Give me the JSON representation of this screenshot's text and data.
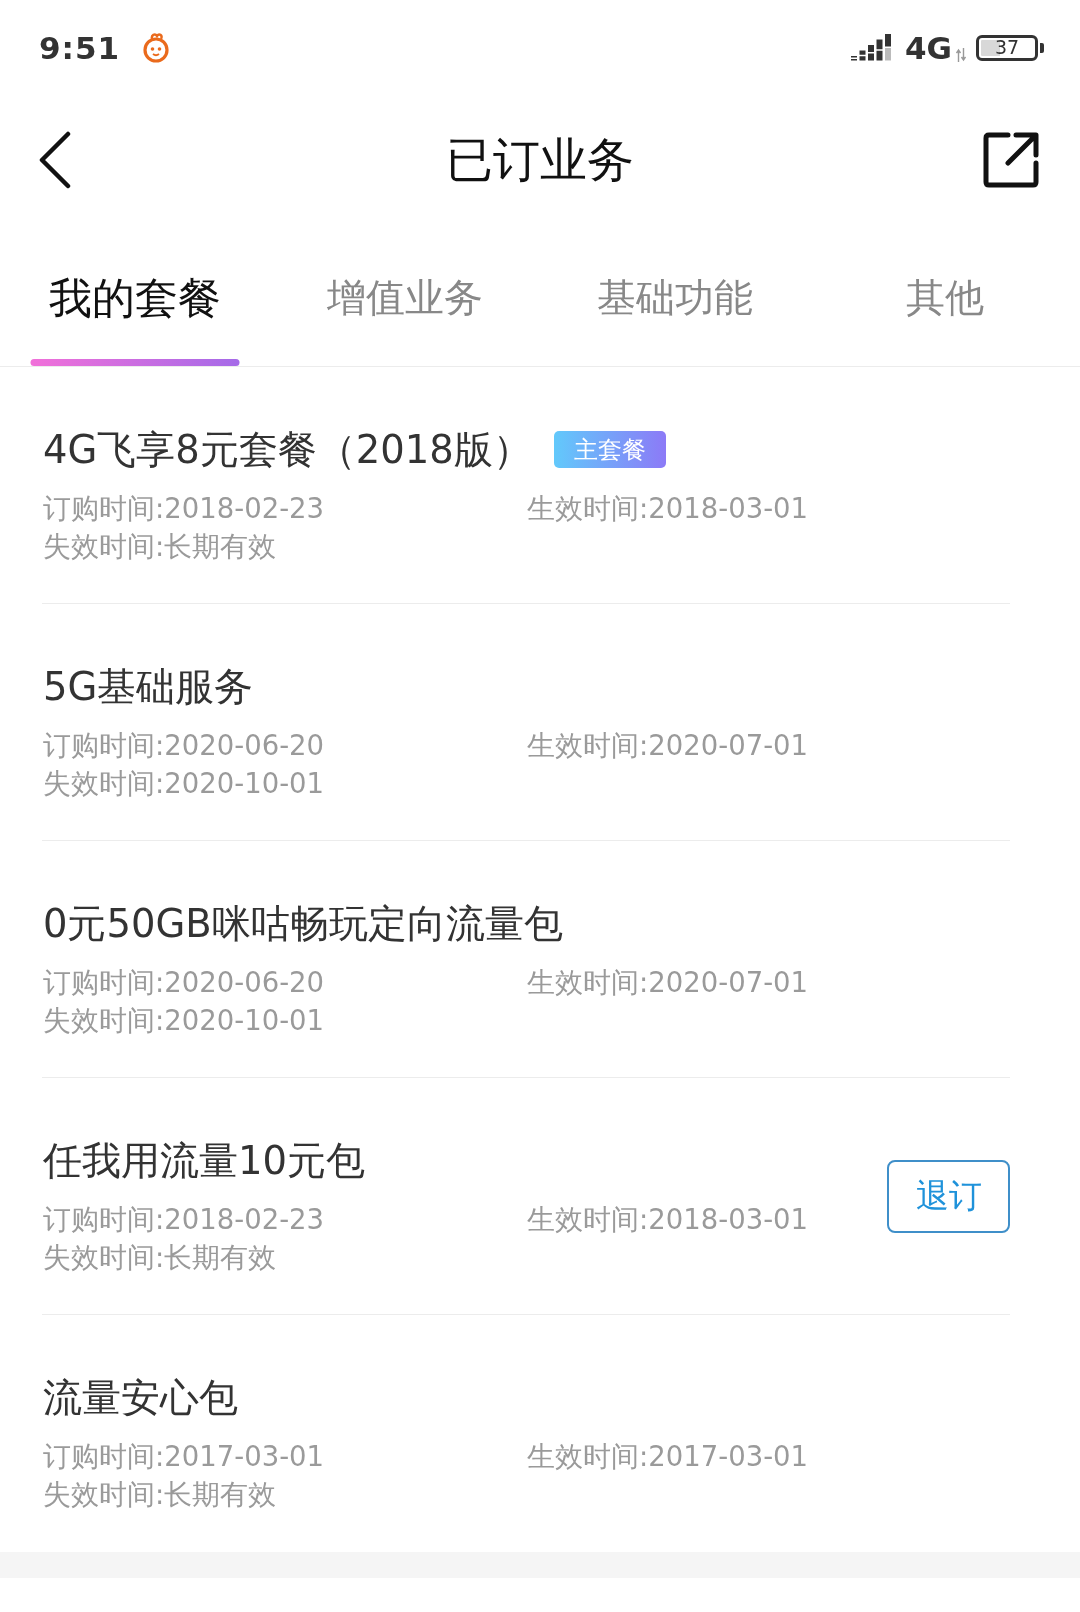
{
  "status_bar": {
    "time": "9:51",
    "network": "4G",
    "battery": "37"
  },
  "header": {
    "title": "已订业务"
  },
  "tabs": [
    {
      "label": "我的套餐",
      "selected": true
    },
    {
      "label": "增值业务",
      "selected": false
    },
    {
      "label": "基础功能",
      "selected": false
    },
    {
      "label": "其他",
      "selected": false
    }
  ],
  "services": [
    {
      "name": "4G飞享8元套餐（2018版）",
      "badge": "主套餐",
      "ordered": "订购时间:2018-02-23",
      "effective": "生效时间:2018-03-01",
      "expires": "失效时间:长期有效"
    },
    {
      "name": "5G基础服务",
      "ordered": "订购时间:2020-06-20",
      "effective": "生效时间:2020-07-01",
      "expires": "失效时间:2020-10-01"
    },
    {
      "name": "0元50GB咪咕畅玩定向流量包",
      "ordered": "订购时间:2020-06-20",
      "effective": "生效时间:2020-07-01",
      "expires": "失效时间:2020-10-01"
    },
    {
      "name": "任我用流量10元包",
      "ordered": "订购时间:2018-02-23",
      "effective": "生效时间:2018-03-01",
      "expires": "失效时间:长期有效",
      "action": "退订"
    },
    {
      "name": "流量安心包",
      "ordered": "订购时间:2017-03-01",
      "effective": "生效时间:2017-03-01",
      "expires": "失效时间:长期有效"
    }
  ]
}
